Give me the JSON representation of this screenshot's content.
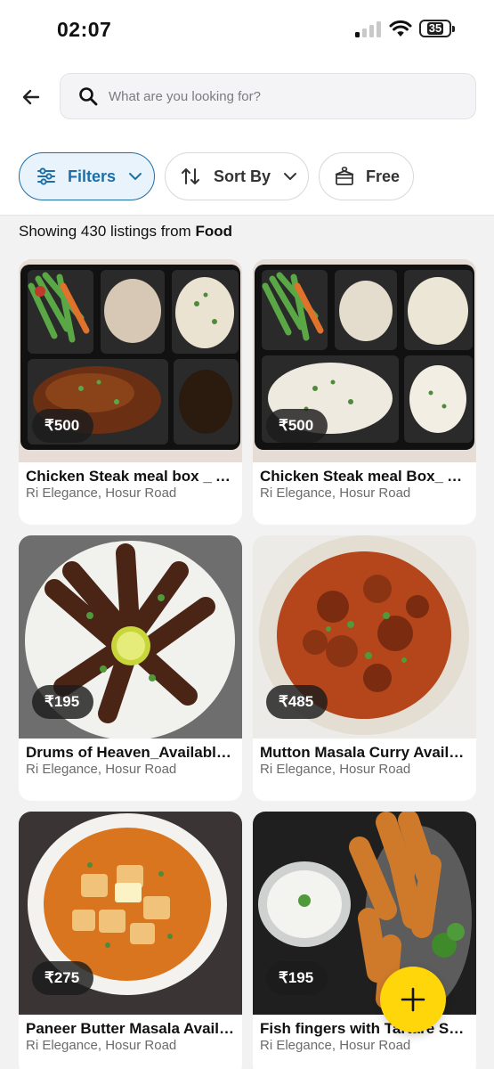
{
  "status_bar": {
    "time": "02:07",
    "battery_level": "35"
  },
  "header": {
    "search_placeholder": "What are you looking for?"
  },
  "filters": [
    {
      "label": "Filters",
      "active": true
    },
    {
      "label": "Sort By",
      "active": false
    },
    {
      "label": "Free",
      "active": false
    }
  ],
  "summary": {
    "prefix": "Showing 430 listings from",
    "category": "Food"
  },
  "listings": [
    {
      "title": "Chicken Steak meal box _ Available on Saturday",
      "price": "₹500",
      "location": "Ri Elegance, Hosur Road",
      "icon": "meal-box-photo"
    },
    {
      "title": "Chicken Steak meal Box_ Available on Saturday",
      "price": "₹500",
      "location": "Ri Elegance, Hosur Road",
      "icon": "meal-box-photo"
    },
    {
      "title": "Drums of Heaven_Available on Saturday",
      "price": "₹195",
      "location": "Ri Elegance, Hosur Road",
      "icon": "drums-of-heaven-photo"
    },
    {
      "title": "Mutton Masala Curry Available on Saturday",
      "price": "₹485",
      "location": "Ri Elegance, Hosur Road",
      "icon": "mutton-curry-photo"
    },
    {
      "title": "Paneer Butter Masala Available on Saturday",
      "price": "₹275",
      "location": "Ri Elegance, Hosur Road",
      "icon": "paneer-photo"
    },
    {
      "title": "Fish fingers with Tartare Sauce",
      "price": "₹195",
      "location": "Ri Elegance, Hosur Road",
      "icon": "fish-fingers-photo"
    }
  ],
  "colors": {
    "accent": "#1e6fa8",
    "fab": "#ffd60a",
    "price_badge": "#1c1c1c"
  }
}
